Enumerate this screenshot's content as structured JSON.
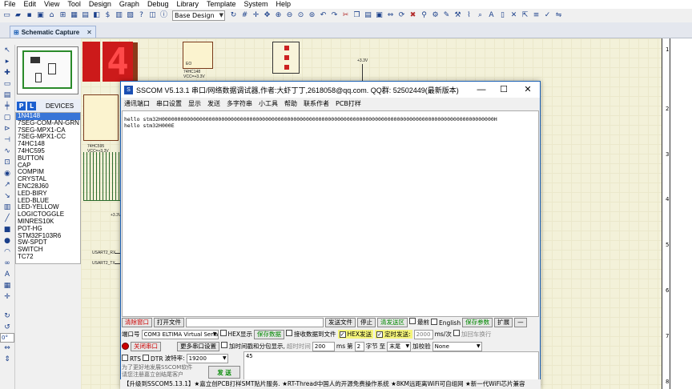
{
  "menubar": [
    "File",
    "Edit",
    "View",
    "Tool",
    "Design",
    "Graph",
    "Debug",
    "Library",
    "Template",
    "System",
    "Help"
  ],
  "toolbar": {
    "design_combo": "Base Design"
  },
  "tab": {
    "label": "Schematic Capture",
    "close": "✕"
  },
  "devices": {
    "p_label": "P",
    "l_label": "L",
    "title": "DEVICES",
    "items": [
      "1N4148",
      "7SEG-COM-AN-GRN",
      "7SEG-MPX1-CA",
      "7SEG-MPX1-CC",
      "74HC148",
      "74HC595",
      "BUTTON",
      "CAP",
      "COMPIM",
      "CRYSTAL",
      "ENC28J60",
      "LED-BIRY",
      "LED-BLUE",
      "LED-YELLOW",
      "LOGICTOGGLE",
      "MINRES10K",
      "POT-HG",
      "STM32F103R6",
      "SW-SPDT",
      "SWITCH",
      "TC72"
    ],
    "selected_index": 0
  },
  "angle_value": "0°",
  "schematic": {
    "digit": "4",
    "chip1_name": "74HC148",
    "chip1_vcc": "VCC=+3.3V",
    "chip2_name": "74HC595",
    "chip2_vcc": "VCC=+3.3V",
    "chip1_pin": "EO",
    "vcc_label": "+3.3V",
    "net1": "USART2_RX",
    "net2": "USART2_TX",
    "row_numbers": [
      "1",
      "2",
      "3",
      "4",
      "5",
      "6",
      "7",
      "8"
    ]
  },
  "sscom": {
    "logo": "S",
    "title": "SSCOM V5.13.1 串口/网络数据调试器,作者:大虾丁丁,2618058@qq.com. QQ群: 52502449(最新版本)",
    "minimize": "—",
    "maximize": "☐",
    "close": "✕",
    "menu": [
      "通讯端口",
      "串口设置",
      "显示",
      "发送",
      "多字符串",
      "小工具",
      "帮助",
      "联系作者",
      "PCB打样"
    ],
    "receive_lines": [
      "hello stm32H0000000000000000000000000000000000000000000000000000000000000000000000000000000000000000000000000000000000H",
      "hello stm32H000E"
    ],
    "row1": {
      "clear_btn": "清除窗口",
      "open_file_btn": "打开文件",
      "send_file_btn": "发送文件",
      "stop_btn": "停止",
      "clear_send_btn": "清发送区",
      "last_label": "最前",
      "english_label": "English",
      "save_params_btn": "保存参数",
      "expand_btn": "扩展",
      "dash_btn": "—"
    },
    "row2": {
      "port_label": "端口号",
      "port_value": "COM3 ELTIMA Virtual Serial",
      "hex_show_label": "HEX显示",
      "save_data_btn": "保存数据",
      "recv_to_file_label": "接收数据到文件",
      "hex_send_label": "HEX发送",
      "timed_send_label": "定时发送:",
      "interval_value": "2000",
      "interval_unit": "ms/次",
      "add_enter_label": "加回车换行"
    },
    "row3": {
      "close_port_btn": "关闭串口",
      "more_settings_btn": "更多串口设置",
      "timestamp_label": "加时间戳和分包显示,",
      "timeout_label": "超时时间",
      "timeout_value": "200",
      "timeout_unit": "ms",
      "nth_label": "第",
      "byte_index": "2",
      "byte_label": "字节",
      "to_label": "至",
      "end_value": "末尾",
      "checksum_label": "加校验",
      "checksum_value": "None"
    },
    "row4": {
      "rts_label": "RTS",
      "dtr_label": "DTR",
      "baud_label": "波特率:",
      "baud_value": "19200",
      "send_text": "45"
    },
    "promo_text": "为了更好地发展SSCOM软件\n请您注册嘉立创结尾客户",
    "send_btn": "发 送",
    "statusbar": "【升级到SSCOM5.13.1】★嘉立创PCB打样SMT贴片服务. ★RT-Thread中国人的开源免费操作系统 ★8KM远距离WiFi可自组网 ★新一代WiFi芯片兼容"
  },
  "colors": {
    "accent": "#1a5fb4",
    "schematic_bg": "#f3f1d9",
    "segment": "#cc1a1a"
  }
}
